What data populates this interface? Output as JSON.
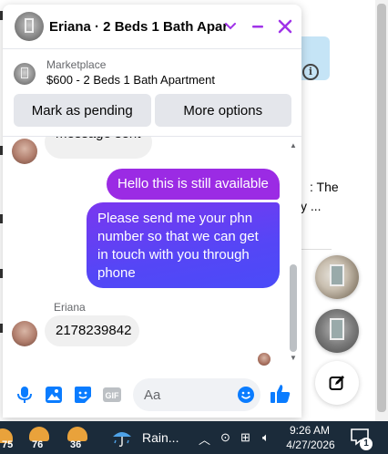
{
  "chat": {
    "title": "Eriana · 2 Beds 1 Bath Apar...",
    "marketplace_label": "Marketplace",
    "listing": "$600 - 2 Beds 1 Bath Apartment",
    "actions": {
      "mark_pending": "Mark as pending",
      "more_options": "More options"
    },
    "messages": {
      "partial_top": "message sent",
      "outgoing_1": "Hello this is still available",
      "outgoing_2": "Please send me your phn number so that we can get in touch with you through phone",
      "sender_name": "Eriana",
      "incoming_1": "2178239842"
    },
    "composer": {
      "placeholder": "Aa",
      "gif_label": "GIF"
    }
  },
  "background": {
    "text_the": ": The",
    "text_dots": "y ...",
    "info_symbol": "i"
  },
  "taskbar": {
    "widget_1_temp": "75",
    "widget_2_temp": "76",
    "widget_3_temp": "36",
    "weather_text": "Rain...",
    "time": "9:26 AM",
    "date": "4/27/2026",
    "notification_count": "1"
  },
  "colors": {
    "accent_purple": "#9b2be4",
    "accent_blue": "#4a4bf8",
    "messenger_blue": "#0a7cff",
    "taskbar_bg": "#1b2b3a"
  },
  "icons": [
    "minus-icon",
    "close-icon",
    "chevron-down-icon",
    "microphone-icon",
    "image-icon",
    "sticker-icon",
    "gif-icon",
    "emoji-icon",
    "thumbs-up-icon",
    "compose-icon",
    "info-icon",
    "rain-icon",
    "notification-icon"
  ]
}
